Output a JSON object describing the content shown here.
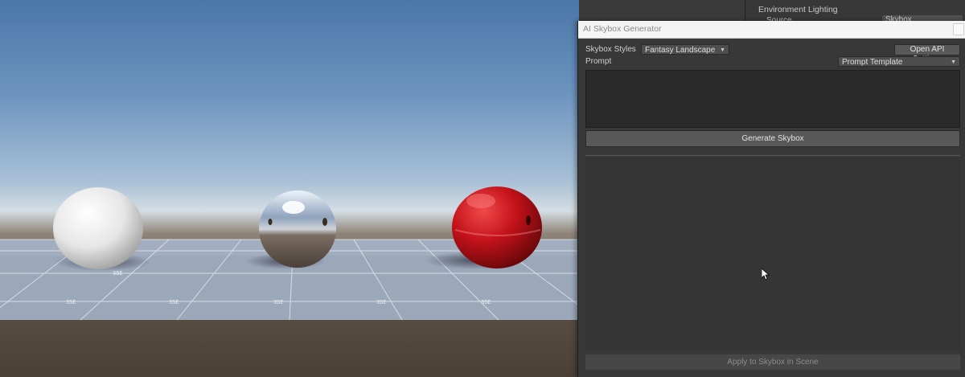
{
  "inspector": {
    "section_title": "Environment Lighting",
    "source_label": "Source",
    "source_value": "Skybox"
  },
  "window": {
    "title": "AI Skybox Generator",
    "skybox_styles_label": "Skybox Styles",
    "skybox_style_value": "Fantasy Landscape",
    "open_api_settings_label": "Open API Settings",
    "prompt_label": "Prompt",
    "prompt_template_value": "Prompt Template",
    "prompt_text": "",
    "generate_button_label": "Generate Skybox",
    "apply_button_label": "Apply to Skybox in Scene"
  },
  "scene": {
    "spheres": [
      {
        "name": "white-sphere",
        "color": "#e8e8e8"
      },
      {
        "name": "chrome-sphere",
        "color": "#b8b8c0"
      },
      {
        "name": "red-sphere",
        "color": "#b80d12"
      }
    ],
    "grid_labels": [
      "35E",
      "35E",
      "35E",
      "35E",
      "35E",
      "35E"
    ]
  },
  "icons": {
    "close": "close-icon",
    "dropdown_arrow": "chevron-down-icon",
    "cursor": "mouse-cursor-icon"
  }
}
